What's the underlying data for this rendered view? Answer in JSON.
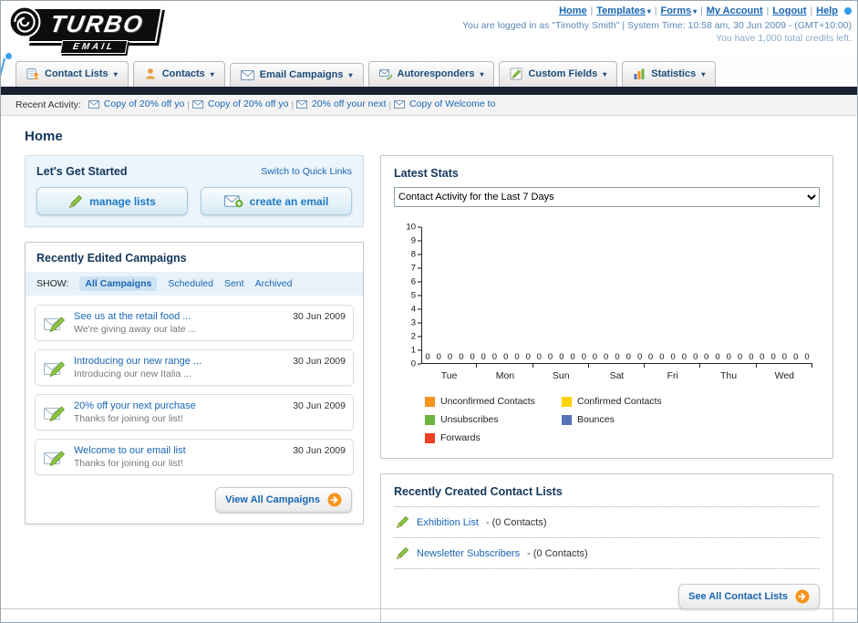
{
  "header": {
    "logo_primary": "TURBO",
    "logo_secondary": "EMAIL",
    "links": [
      {
        "label": "Home",
        "dropdown": false
      },
      {
        "label": "Templates",
        "dropdown": true
      },
      {
        "label": "Forms",
        "dropdown": true
      },
      {
        "label": "My Account",
        "dropdown": false
      },
      {
        "label": "Logout",
        "dropdown": false
      },
      {
        "label": "Help",
        "dropdown": false
      }
    ],
    "login_info": "You are logged in as \"Timothy Smith\" | System Time: 10:58 am, 30 Jun 2009 - (GMT+10:00)",
    "credits": "You have 1,000 total credits left."
  },
  "nav": {
    "tabs": [
      {
        "label": "Contact Lists",
        "icon": "contact-lists-icon"
      },
      {
        "label": "Contacts",
        "icon": "contacts-icon"
      },
      {
        "label": "Email Campaigns",
        "icon": "email-campaigns-icon"
      },
      {
        "label": "Autoresponders",
        "icon": "autoresponders-icon"
      },
      {
        "label": "Custom Fields",
        "icon": "custom-fields-icon"
      },
      {
        "label": "Statistics",
        "icon": "statistics-icon"
      }
    ]
  },
  "recent_activity": {
    "label": "Recent Activity:",
    "items": [
      "Copy of 20% off yo",
      "Copy of 20% off yo",
      "20% off your next ",
      "Copy of Welcome to"
    ]
  },
  "page_title": "Home",
  "get_started": {
    "title": "Let's Get Started",
    "switch_link": "Switch to Quick Links",
    "buttons": [
      {
        "label": "manage lists"
      },
      {
        "label": "create an email"
      }
    ]
  },
  "campaigns": {
    "title": "Recently Edited Campaigns",
    "show_label": "SHOW:",
    "tabs": [
      "All Campaigns",
      "Scheduled",
      "Sent",
      "Archived"
    ],
    "active_tab": "All Campaigns",
    "items": [
      {
        "title": "See us at the retail food ...",
        "subtitle": "We're giving away our late ...",
        "date": "30 Jun 2009"
      },
      {
        "title": "Introducing our new range ...",
        "subtitle": "Introducing our new Italia ...",
        "date": "30 Jun 2009"
      },
      {
        "title": "20% off your next purchase",
        "subtitle": "Thanks for joining our list!",
        "date": "30 Jun 2009"
      },
      {
        "title": "Welcome to our email list",
        "subtitle": "Thanks for joining our list!",
        "date": "30 Jun 2009"
      }
    ],
    "view_all": "View All Campaigns"
  },
  "stats": {
    "title": "Latest Stats",
    "dropdown_value": "Contact Activity for the Last 7 Days",
    "chart_data": {
      "type": "bar",
      "title": "Contact Activity for the Last 7 Days",
      "categories": [
        "Tue",
        "Mon",
        "Sun",
        "Sat",
        "Fri",
        "Thu",
        "Wed"
      ],
      "series": [
        {
          "name": "Unconfirmed Contacts",
          "color": "#f7941d",
          "values": [
            0,
            0,
            0,
            0,
            0,
            0,
            0
          ]
        },
        {
          "name": "Confirmed Contacts",
          "color": "#ffd200",
          "values": [
            0,
            0,
            0,
            0,
            0,
            0,
            0
          ]
        },
        {
          "name": "Unsubscribes",
          "color": "#6cb33f",
          "values": [
            0,
            0,
            0,
            0,
            0,
            0,
            0
          ]
        },
        {
          "name": "Bounces",
          "color": "#5674b9",
          "values": [
            0,
            0,
            0,
            0,
            0,
            0,
            0
          ]
        },
        {
          "name": "Forwards",
          "color": "#ee4023",
          "values": [
            0,
            0,
            0,
            0,
            0,
            0,
            0
          ]
        }
      ],
      "ylim": [
        0,
        10
      ],
      "ytick_step": 1,
      "grid": false,
      "legend_position": "bottom",
      "show_zero_labels": true
    }
  },
  "contact_lists": {
    "title": "Recently Created Contact Lists",
    "items": [
      {
        "name": "Exhibition List",
        "detail": "- (0 Contacts)"
      },
      {
        "name": "Newsletter Subscribers",
        "detail": "- (0 Contacts)"
      }
    ],
    "see_all": "See All Contact Lists"
  }
}
